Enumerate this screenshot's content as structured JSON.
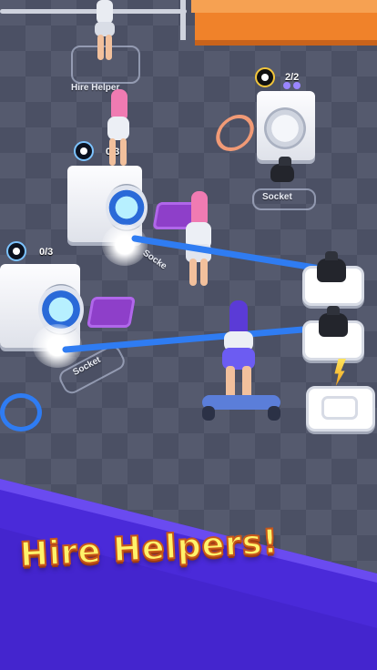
{
  "hud": {
    "hire_helper_label": "Hire Helper",
    "top_washer_counter": "2/2",
    "washer_left_upper_counter": "0/3",
    "washer_left_lower_counter": "0/3"
  },
  "floor_labels": {
    "socket_top": "Socket",
    "socket_mid": "Socke",
    "socket_bottom": "Socket"
  },
  "banner": {
    "text": "Hire Helpers!"
  },
  "colors": {
    "hose": "#2f7cf2",
    "banner_purple": "#4a2ad9",
    "banner_text": "#fff36b",
    "orange_wall": "#f0822a"
  }
}
